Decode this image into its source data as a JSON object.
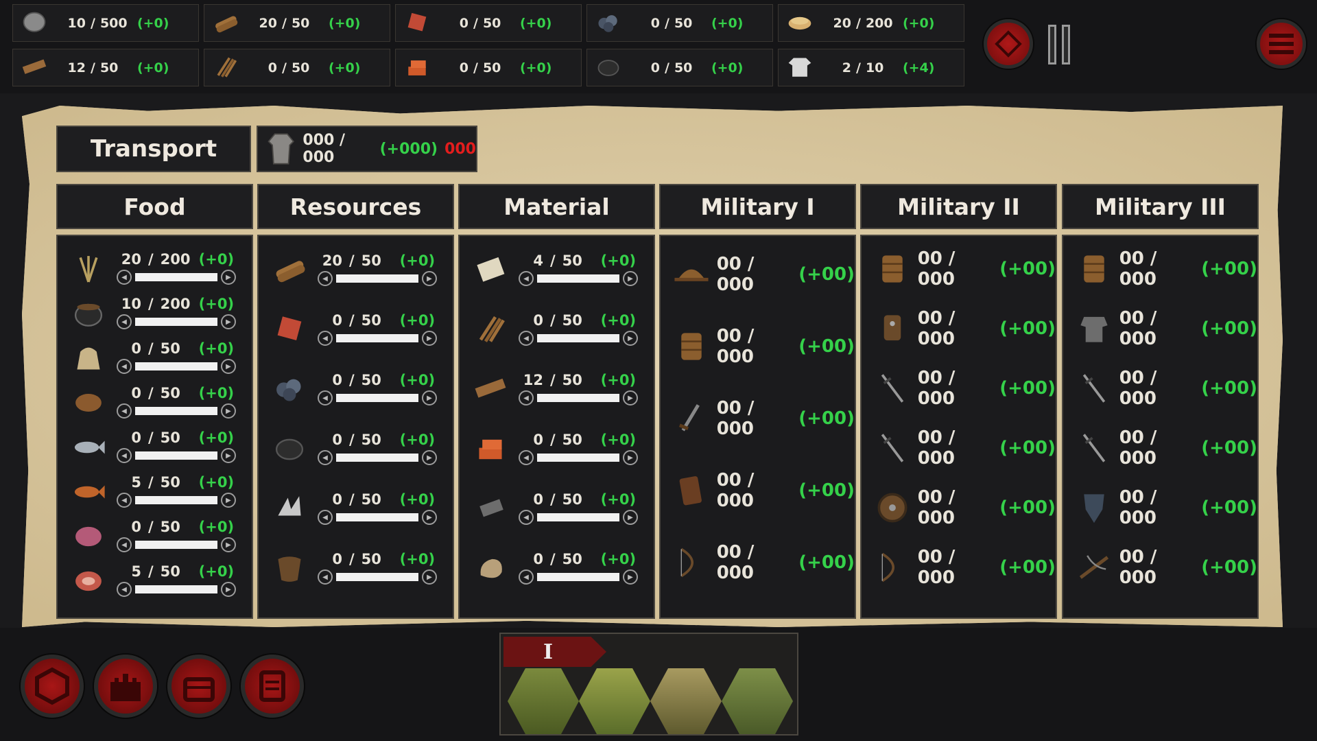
{
  "top_resources": [
    {
      "icon": "stone-icon",
      "cur": "10",
      "max": "500",
      "delta": "(+0)"
    },
    {
      "icon": "logs-icon",
      "cur": "20",
      "max": "50",
      "delta": "(+0)"
    },
    {
      "icon": "clay-icon",
      "cur": "0",
      "max": "50",
      "delta": "(+0)"
    },
    {
      "icon": "ore-icon",
      "cur": "0",
      "max": "50",
      "delta": "(+0)"
    },
    {
      "icon": "bread-icon",
      "cur": "20",
      "max": "200",
      "delta": "(+0)"
    },
    {
      "icon": "plank-icon",
      "cur": "12",
      "max": "50",
      "delta": "(+0)"
    },
    {
      "icon": "sticks-icon",
      "cur": "0",
      "max": "50",
      "delta": "(+0)"
    },
    {
      "icon": "bricks-icon",
      "cur": "0",
      "max": "50",
      "delta": "(+0)"
    },
    {
      "icon": "coal-icon",
      "cur": "0",
      "max": "50",
      "delta": "(+0)"
    },
    {
      "icon": "shirt-icon",
      "cur": "2",
      "max": "10",
      "delta": "(+4)"
    }
  ],
  "transport": {
    "label": "Transport",
    "value": "000 / 000",
    "delta": "(+000)",
    "neg": "000"
  },
  "columns": {
    "food": {
      "title": "Food",
      "rows": [
        {
          "icon": "wheat-icon",
          "cur": "20",
          "max": "200",
          "delta": "(+0)"
        },
        {
          "icon": "cauldron-icon",
          "cur": "10",
          "max": "200",
          "delta": "(+0)"
        },
        {
          "icon": "flour-sack-icon",
          "cur": "0",
          "max": "50",
          "delta": "(+0)"
        },
        {
          "icon": "potato-icon",
          "cur": "0",
          "max": "50",
          "delta": "(+0)"
        },
        {
          "icon": "fish-icon",
          "cur": "0",
          "max": "50",
          "delta": "(+0)"
        },
        {
          "icon": "cooked-fish-icon",
          "cur": "5",
          "max": "50",
          "delta": "(+0)"
        },
        {
          "icon": "raw-meat-icon",
          "cur": "0",
          "max": "50",
          "delta": "(+0)"
        },
        {
          "icon": "steak-icon",
          "cur": "5",
          "max": "50",
          "delta": "(+0)"
        }
      ]
    },
    "resources": {
      "title": "Resources",
      "rows": [
        {
          "icon": "logs-icon",
          "cur": "20",
          "max": "50",
          "delta": "(+0)"
        },
        {
          "icon": "clay-icon",
          "cur": "0",
          "max": "50",
          "delta": "(+0)"
        },
        {
          "icon": "ore-icon",
          "cur": "0",
          "max": "50",
          "delta": "(+0)"
        },
        {
          "icon": "coal-icon",
          "cur": "0",
          "max": "50",
          "delta": "(+0)"
        },
        {
          "icon": "wool-icon",
          "cur": "0",
          "max": "50",
          "delta": "(+0)"
        },
        {
          "icon": "hide-icon",
          "cur": "0",
          "max": "50",
          "delta": "(+0)"
        }
      ]
    },
    "material": {
      "title": "Material",
      "rows": [
        {
          "icon": "cloth-roll-icon",
          "cur": "4",
          "max": "50",
          "delta": "(+0)"
        },
        {
          "icon": "sticks-icon",
          "cur": "0",
          "max": "50",
          "delta": "(+0)"
        },
        {
          "icon": "plank-icon",
          "cur": "12",
          "max": "50",
          "delta": "(+0)"
        },
        {
          "icon": "bricks-icon",
          "cur": "0",
          "max": "50",
          "delta": "(+0)"
        },
        {
          "icon": "iron-bar-icon",
          "cur": "0",
          "max": "50",
          "delta": "(+0)"
        },
        {
          "icon": "leather-icon",
          "cur": "0",
          "max": "50",
          "delta": "(+0)"
        }
      ]
    },
    "military1": {
      "title": "Military I",
      "rows": [
        {
          "icon": "helmet-icon",
          "value": "00 / 000",
          "delta": "(+00)"
        },
        {
          "icon": "armor-icon",
          "value": "00 / 000",
          "delta": "(+00)"
        },
        {
          "icon": "dagger-icon",
          "value": "00 / 000",
          "delta": "(+00)"
        },
        {
          "icon": "wooden-shield-icon",
          "value": "00 / 000",
          "delta": "(+00)"
        },
        {
          "icon": "bow-icon",
          "value": "00 / 000",
          "delta": "(+00)"
        }
      ]
    },
    "military2": {
      "title": "Military II",
      "rows": [
        {
          "icon": "armor-icon",
          "value": "00 / 000",
          "delta": "(+00)"
        },
        {
          "icon": "leather-armor-icon",
          "value": "00 / 000",
          "delta": "(+00)"
        },
        {
          "icon": "sword-icon",
          "value": "00 / 000",
          "delta": "(+00)"
        },
        {
          "icon": "sword-icon",
          "value": "00 / 000",
          "delta": "(+00)"
        },
        {
          "icon": "round-shield-icon",
          "value": "00 / 000",
          "delta": "(+00)"
        },
        {
          "icon": "bow-icon",
          "value": "00 / 000",
          "delta": "(+00)"
        }
      ]
    },
    "military3": {
      "title": "Military III",
      "rows": [
        {
          "icon": "armor-icon",
          "value": "00 / 000",
          "delta": "(+00)"
        },
        {
          "icon": "chainmail-icon",
          "value": "00 / 000",
          "delta": "(+00)"
        },
        {
          "icon": "sword-icon",
          "value": "00 / 000",
          "delta": "(+00)"
        },
        {
          "icon": "sword-icon",
          "value": "00 / 000",
          "delta": "(+00)"
        },
        {
          "icon": "kite-shield-icon",
          "value": "00 / 000",
          "delta": "(+00)"
        },
        {
          "icon": "crossbow-icon",
          "value": "00 / 000",
          "delta": "(+00)"
        }
      ]
    }
  },
  "era": {
    "label": "I"
  },
  "colors": {
    "accent_red": "#a81616",
    "positive_green": "#35d14a",
    "negative_red": "#e31d1d",
    "parchment": "#d8c7a0"
  }
}
